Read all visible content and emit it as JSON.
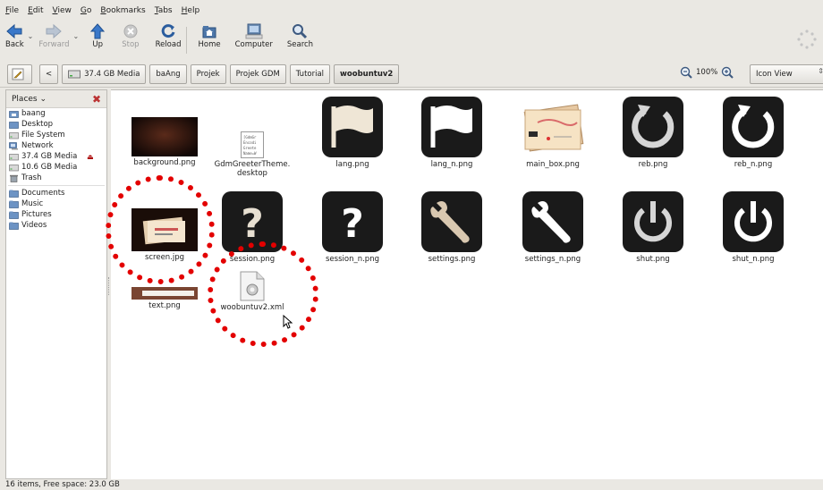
{
  "menubar": [
    {
      "label": "File",
      "u": "F",
      "rest": "ile"
    },
    {
      "label": "Edit",
      "u": "E",
      "rest": "dit"
    },
    {
      "label": "View",
      "u": "V",
      "rest": "iew"
    },
    {
      "label": "Go",
      "u": "G",
      "rest": "o"
    },
    {
      "label": "Bookmarks",
      "u": "B",
      "rest": "ookmarks"
    },
    {
      "label": "Tabs",
      "u": "T",
      "rest": "abs"
    },
    {
      "label": "Help",
      "u": "H",
      "rest": "elp"
    }
  ],
  "toolbar": {
    "back": "Back",
    "forward": "Forward",
    "up": "Up",
    "stop": "Stop",
    "reload": "Reload",
    "home": "Home",
    "computer": "Computer",
    "search": "Search"
  },
  "location": {
    "toggle_arrow": "<",
    "crumbs": [
      "37.4 GB Media",
      "baAng",
      "Projek",
      "Projek GDM",
      "Tutorial",
      "woobuntuv2"
    ],
    "zoom": "100%",
    "view_mode": "Icon View"
  },
  "sidebar": {
    "header": "Places",
    "items": [
      "baang",
      "Desktop",
      "File System",
      "Network",
      "37.4 GB Media",
      "10.6 GB Media",
      "Trash"
    ],
    "bookmarks": [
      "Documents",
      "Music",
      "Pictures",
      "Videos"
    ]
  },
  "files": [
    "background.png",
    "GdmGreeterTheme.",
    "desktop",
    "lang.png",
    "lang_n.png",
    "main_box.png",
    "reb.png",
    "reb_n.png",
    "screen.jpg",
    "session.png",
    "session_n.png",
    "settings.png",
    "settings_n.png",
    "shut.png",
    "shut_n.png",
    "text.png",
    "woobuntuv2.xml"
  ],
  "desktop_file_preview": [
    "[GdmGr",
    "Encodi",
    "Greete",
    "Name=W"
  ],
  "status": "16 items, Free space: 23.0 GB",
  "colors": {
    "highlight_circle": "#e30000",
    "icon_dark": "#1a1a1a"
  }
}
